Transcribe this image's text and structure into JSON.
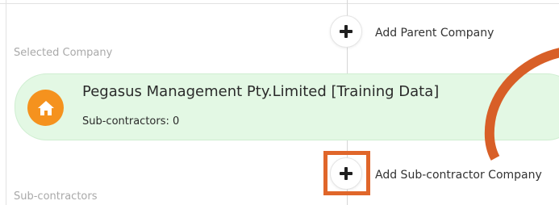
{
  "sections": {
    "selected_company_label": "Selected Company",
    "subcontractors_label": "Sub-contractors"
  },
  "add_parent": {
    "label": "Add Parent Company",
    "icon": "plus-icon"
  },
  "selected_company": {
    "name": "Pegasus Management Pty.Limited [Training Data]",
    "subcontractors_text": "Sub-contractors: 0",
    "icon": "home-icon",
    "card_color": "#e3f8e4",
    "icon_color": "#f5921e"
  },
  "add_subcontractor": {
    "label": "Add Sub-contractor Company",
    "icon": "plus-icon"
  },
  "annotation": {
    "highlight_color": "#e0662a"
  }
}
